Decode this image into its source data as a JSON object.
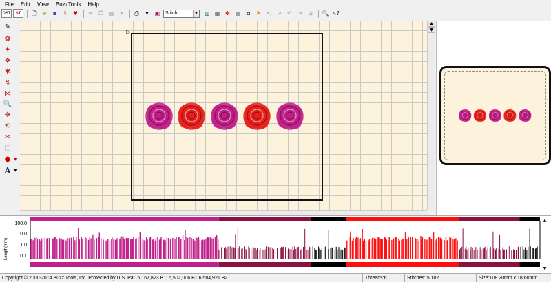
{
  "menu": [
    "File",
    "Edit",
    "View",
    "BuzzTools",
    "Help"
  ],
  "toolbar": {
    "btn_dst": "DST",
    "btn_st": "ST",
    "stitch_mode": "Stitch"
  },
  "graph": {
    "ylabel": "Length(mm)",
    "yticks": [
      "100.0",
      "10.0",
      "1.0",
      "0.1"
    ],
    "thread_colors": [
      "#c0208a",
      "#8a1040",
      "#000000",
      "#ff1010",
      "#8a1040",
      "#000000"
    ],
    "thread_fractions": [
      0.37,
      0.18,
      0.07,
      0.22,
      0.12,
      0.04
    ]
  },
  "status": {
    "copyright": "Copyright © 2000-2014 Buzz Tools, Inc. Protected by U.S. Pat. 6,167,823 B1; 6,502,006 B1;6,584,921 B2",
    "threads": "Threads:6",
    "stitches": "Stitches: 5,102",
    "size": "Size:108.20mm x 18.60mm"
  },
  "colors": {
    "workspace_bg": "#fdf3dc",
    "rose_magenta": "#c0208a",
    "rose_red": "#e8201a"
  }
}
